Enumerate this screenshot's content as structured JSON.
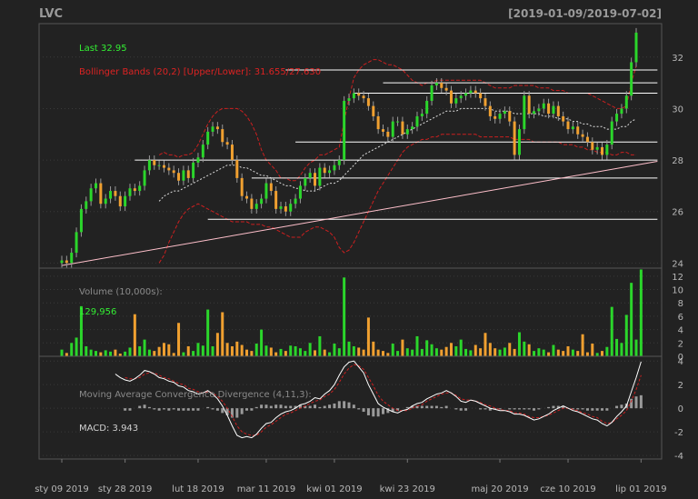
{
  "header": {
    "symbol": "LVC",
    "range": "[2019-01-09/2019-07-02]"
  },
  "annotations": {
    "last": "Last 32.95",
    "bbands": "Bollinger Bands (20,2) [Upper/Lower]: 31.655/27.630",
    "volume_title": "Volume (10,000s):",
    "volume_value": "129,956",
    "macd_title": "Moving Average Convergence Divergence (4,11,3):",
    "macd_value": "MACD: 3.943"
  },
  "colors": {
    "background": "#222222",
    "up": "#2bd62b",
    "down": "#f0a030",
    "bbands": "#cc1f1f",
    "last_text": "#33ee33",
    "bbands_text": "#dd2222",
    "macd_line": "#ffffff",
    "signal_line": "#cc2020",
    "hist": "#9a9a9a",
    "trendline": "#ffc0cb"
  },
  "chart_data": {
    "type": "candlestick",
    "x_ticks": [
      "sty 09 2019",
      "sty 28 2019",
      "lut 18 2019",
      "mar 11 2019",
      "kwi 01 2019",
      "kwi 23 2019",
      "maj 20 2019",
      "cze 10 2019",
      "lip 01 2019"
    ],
    "x_tick_index": [
      0,
      13,
      28,
      42,
      56,
      71,
      90,
      104,
      119
    ],
    "price": {
      "yticks": [
        "24",
        "26",
        "28",
        "30",
        "32"
      ],
      "ylim": [
        23.8,
        33.3
      ],
      "closes": [
        24.1,
        24.0,
        24.4,
        25.2,
        26.1,
        26.4,
        26.9,
        27.1,
        26.3,
        26.5,
        26.8,
        26.6,
        26.2,
        26.6,
        26.9,
        26.8,
        27.0,
        27.6,
        28.0,
        27.8,
        27.8,
        27.7,
        27.6,
        27.5,
        27.2,
        27.6,
        27.3,
        27.9,
        28.1,
        28.6,
        29.1,
        29.3,
        29.2,
        28.7,
        28.6,
        28.0,
        27.3,
        26.6,
        26.5,
        26.1,
        26.3,
        26.5,
        27.1,
        26.8,
        26.1,
        26.2,
        26.0,
        26.3,
        26.5,
        27.0,
        27.3,
        27.5,
        27.0,
        27.7,
        27.5,
        27.6,
        27.8,
        28.0,
        30.3,
        30.4,
        30.6,
        30.5,
        30.4,
        30.1,
        29.7,
        29.2,
        29.1,
        28.9,
        29.5,
        29.5,
        29.0,
        29.2,
        29.3,
        29.7,
        29.8,
        30.3,
        30.9,
        31.0,
        30.8,
        30.7,
        30.2,
        30.4,
        30.5,
        30.6,
        30.7,
        30.6,
        30.4,
        30.1,
        29.7,
        29.6,
        29.8,
        29.9,
        29.5,
        28.2,
        29.2,
        30.5,
        29.8,
        29.9,
        30.0,
        30.2,
        29.8,
        30.1,
        29.7,
        29.5,
        29.2,
        29.3,
        29.0,
        28.9,
        28.7,
        28.4,
        28.5,
        28.2,
        28.6,
        29.5,
        29.8,
        30.0,
        30.5,
        31.8,
        32.95
      ],
      "bb_upper": [
        null,
        null,
        null,
        null,
        null,
        null,
        null,
        null,
        null,
        null,
        null,
        null,
        null,
        null,
        null,
        null,
        null,
        null,
        null,
        null,
        28.2,
        28.3,
        28.2,
        28.2,
        28.1,
        28.2,
        28.2,
        28.3,
        28.6,
        29.0,
        29.4,
        29.7,
        29.9,
        30.0,
        30.0,
        30.0,
        30.0,
        29.9,
        29.7,
        29.4,
        29.0,
        28.4,
        28.0,
        27.8,
        27.6,
        27.3,
        27.3,
        27.2,
        27.2,
        27.4,
        27.7,
        27.9,
        28.0,
        28.2,
        28.2,
        28.3,
        28.4,
        28.5,
        29.5,
        30.4,
        31.2,
        31.5,
        31.7,
        31.8,
        31.9,
        31.9,
        31.8,
        31.7,
        31.7,
        31.6,
        31.5,
        31.3,
        31.1,
        31.0,
        30.9,
        31.0,
        31.0,
        31.1,
        31.1,
        31.1,
        31.1,
        31.1,
        31.1,
        31.1,
        31.1,
        31.1,
        31.1,
        31.0,
        30.9,
        30.8,
        30.8,
        30.8,
        30.8,
        30.9,
        30.9,
        30.9,
        30.9,
        30.9,
        30.8,
        30.8,
        30.8,
        30.7,
        30.7,
        30.7,
        30.6,
        30.6,
        30.6,
        30.6,
        30.6,
        30.5,
        30.4,
        30.3,
        30.2,
        30.1,
        30.0,
        30.0,
        30.1,
        31.0,
        31.65
      ],
      "bb_middle": [
        null,
        null,
        null,
        null,
        null,
        null,
        null,
        null,
        null,
        null,
        null,
        null,
        null,
        null,
        null,
        null,
        null,
        null,
        null,
        null,
        26.4,
        26.6,
        26.7,
        26.8,
        26.8,
        26.9,
        27.0,
        27.1,
        27.2,
        27.3,
        27.4,
        27.5,
        27.6,
        27.7,
        27.8,
        27.8,
        27.8,
        27.7,
        27.7,
        27.6,
        27.5,
        27.4,
        27.4,
        27.3,
        27.2,
        27.1,
        27.0,
        27.0,
        26.9,
        26.9,
        26.8,
        26.8,
        26.8,
        26.9,
        27.0,
        27.1,
        27.1,
        27.2,
        27.4,
        27.6,
        27.8,
        28.0,
        28.2,
        28.3,
        28.4,
        28.5,
        28.6,
        28.7,
        28.8,
        28.9,
        29.0,
        29.1,
        29.2,
        29.3,
        29.4,
        29.5,
        29.6,
        29.7,
        29.8,
        29.9,
        29.9,
        29.9,
        30.0,
        30.0,
        30.0,
        30.0,
        30.0,
        30.0,
        30.0,
        29.9,
        29.9,
        29.9,
        29.9,
        29.8,
        29.8,
        29.8,
        29.8,
        29.8,
        29.8,
        29.7,
        29.7,
        29.7,
        29.6,
        29.6,
        29.6,
        29.5,
        29.5,
        29.4,
        29.4,
        29.3,
        29.3,
        29.3,
        29.2,
        29.2,
        29.2,
        29.3,
        29.3,
        29.5,
        29.6
      ],
      "bb_lower": [
        null,
        null,
        null,
        null,
        null,
        null,
        null,
        null,
        null,
        null,
        null,
        null,
        null,
        null,
        null,
        null,
        null,
        null,
        null,
        null,
        24.0,
        24.3,
        24.8,
        25.2,
        25.6,
        25.9,
        26.1,
        26.2,
        26.3,
        26.2,
        26.1,
        26.0,
        25.9,
        25.8,
        25.7,
        25.6,
        25.6,
        25.6,
        25.6,
        25.5,
        25.5,
        25.5,
        25.4,
        25.4,
        25.3,
        25.2,
        25.1,
        25.0,
        25.0,
        25.0,
        25.2,
        25.3,
        25.4,
        25.4,
        25.3,
        25.2,
        25.0,
        24.6,
        24.4,
        24.5,
        24.8,
        25.2,
        25.6,
        26.0,
        26.4,
        26.8,
        27.1,
        27.4,
        27.7,
        28.0,
        28.3,
        28.5,
        28.6,
        28.7,
        28.8,
        28.8,
        28.9,
        28.9,
        29.0,
        29.0,
        29.0,
        29.0,
        29.0,
        29.0,
        29.0,
        29.0,
        28.9,
        28.9,
        28.9,
        28.9,
        28.9,
        28.9,
        28.9,
        28.8,
        28.8,
        28.8,
        28.8,
        28.7,
        28.7,
        28.7,
        28.7,
        28.7,
        28.7,
        28.6,
        28.6,
        28.6,
        28.5,
        28.5,
        28.4,
        28.4,
        28.3,
        28.3,
        28.3,
        28.2,
        28.2,
        28.3,
        28.3,
        28.2,
        28.2
      ],
      "hlines": [
        {
          "y": 31.5,
          "x0": 46,
          "x1": 119
        },
        {
          "y": 31.0,
          "x0": 66,
          "x1": 119
        },
        {
          "y": 30.6,
          "x0": 60,
          "x1": 119
        },
        {
          "y": 28.7,
          "x0": 48,
          "x1": 119
        },
        {
          "y": 28.0,
          "x0": 15,
          "x1": 119
        },
        {
          "y": 27.3,
          "x0": 39,
          "x1": 119
        },
        {
          "y": 25.7,
          "x0": 30,
          "x1": 119
        }
      ],
      "trendline": {
        "from": [
          0,
          23.9
        ],
        "to": [
          119,
          27.95
        ]
      }
    },
    "volume": {
      "yticks": [
        "0",
        "2",
        "4",
        "6",
        "8",
        "10",
        "12"
      ],
      "ylim": [
        0,
        13.2
      ],
      "values": [
        1.0,
        0.5,
        2.0,
        2.8,
        7.5,
        1.5,
        1.0,
        0.8,
        0.6,
        0.9,
        0.7,
        1.0,
        0.4,
        0.7,
        1.3,
        6.3,
        1.5,
        2.5,
        1.0,
        0.8,
        1.4,
        2.0,
        1.8,
        0.5,
        5.0,
        0.6,
        1.5,
        0.8,
        2.0,
        1.6,
        7.0,
        1.5,
        3.5,
        6.6,
        2.0,
        1.5,
        2.2,
        1.7,
        1.0,
        0.8,
        1.9,
        4.0,
        1.6,
        1.3,
        0.6,
        1.1,
        0.8,
        1.6,
        1.5,
        1.2,
        0.8,
        2.0,
        0.9,
        3.0,
        1.0,
        0.6,
        1.9,
        1.2,
        11.8,
        2.2,
        1.5,
        1.3,
        1.0,
        5.8,
        2.2,
        1.0,
        0.8,
        0.5,
        1.9,
        0.8,
        2.5,
        1.2,
        1.0,
        3.0,
        1.1,
        2.4,
        1.8,
        1.2,
        1.0,
        1.4,
        2.0,
        1.5,
        2.5,
        1.1,
        0.9,
        1.7,
        1.2,
        3.5,
        2.0,
        1.2,
        1.0,
        1.3,
        2.0,
        1.1,
        3.6,
        2.2,
        1.8,
        0.8,
        1.2,
        1.0,
        0.6,
        1.7,
        1.0,
        0.8,
        1.5,
        1.0,
        0.8,
        3.3,
        0.6,
        1.9,
        0.5,
        0.8,
        1.4,
        7.4,
        2.6,
        2.0,
        6.2,
        11.0,
        2.5,
        13.0
      ],
      "up": [
        1,
        0,
        1,
        1,
        1,
        1,
        1,
        1,
        0,
        1,
        1,
        0,
        0,
        1,
        1,
        0,
        1,
        1,
        1,
        0,
        0,
        0,
        0,
        0,
        0,
        1,
        0,
        1,
        1,
        1,
        1,
        1,
        0,
        0,
        0,
        0,
        0,
        0,
        0,
        0,
        1,
        1,
        1,
        0,
        0,
        1,
        0,
        1,
        1,
        1,
        1,
        1,
        0,
        1,
        0,
        1,
        1,
        1,
        1,
        1,
        1,
        0,
        0,
        0,
        0,
        0,
        0,
        0,
        1,
        1,
        0,
        1,
        1,
        1,
        1,
        1,
        1,
        1,
        0,
        0,
        0,
        1,
        1,
        1,
        1,
        0,
        0,
        0,
        0,
        0,
        1,
        1,
        0,
        0,
        1,
        1,
        0,
        1,
        1,
        1,
        0,
        1,
        0,
        0,
        0,
        1,
        0,
        0,
        0,
        0,
        1,
        0,
        1,
        1,
        1,
        1,
        1,
        1,
        1,
        1
      ]
    },
    "macd": {
      "yticks": [
        "-4",
        "-2",
        "0",
        "2",
        "4"
      ],
      "ylim": [
        -4.3,
        4.4
      ],
      "macd": [
        null,
        null,
        null,
        null,
        null,
        null,
        null,
        null,
        null,
        null,
        null,
        2.9,
        2.6,
        2.4,
        2.3,
        2.5,
        2.8,
        3.2,
        3.1,
        2.9,
        2.6,
        2.5,
        2.3,
        2.2,
        1.9,
        1.8,
        1.5,
        1.4,
        1.2,
        1.3,
        1.5,
        1.2,
        0.8,
        0.2,
        -0.6,
        -1.5,
        -2.3,
        -2.5,
        -2.4,
        -2.5,
        -2.2,
        -1.7,
        -1.3,
        -1.2,
        -0.8,
        -0.5,
        -0.3,
        -0.2,
        0.0,
        0.3,
        0.4,
        0.6,
        0.9,
        0.8,
        1.2,
        1.5,
        2.0,
        2.8,
        3.5,
        3.9,
        4.0,
        3.5,
        3.0,
        2.0,
        1.2,
        0.4,
        0.1,
        -0.1,
        -0.3,
        -0.4,
        -0.2,
        -0.1,
        0.2,
        0.4,
        0.5,
        0.8,
        1.0,
        1.2,
        1.3,
        1.5,
        1.3,
        1.0,
        0.6,
        0.5,
        0.7,
        0.6,
        0.4,
        0.2,
        0.0,
        -0.1,
        -0.2,
        -0.2,
        -0.3,
        -0.5,
        -0.5,
        -0.6,
        -0.8,
        -1.0,
        -0.9,
        -0.7,
        -0.5,
        -0.2,
        0.0,
        0.2,
        0.0,
        -0.2,
        -0.3,
        -0.5,
        -0.7,
        -0.9,
        -1.0,
        -1.3,
        -1.5,
        -1.2,
        -0.7,
        -0.3,
        0.2,
        1.4,
        2.6,
        3.943
      ],
      "signal": [
        null,
        null,
        null,
        null,
        null,
        null,
        null,
        null,
        null,
        null,
        null,
        null,
        null,
        2.6,
        2.5,
        2.5,
        2.6,
        2.9,
        3.0,
        3.0,
        2.8,
        2.6,
        2.5,
        2.3,
        2.1,
        2.0,
        1.7,
        1.6,
        1.4,
        1.3,
        1.4,
        1.3,
        1.0,
        0.6,
        0.0,
        -0.7,
        -1.5,
        -2.0,
        -2.2,
        -2.3,
        -2.3,
        -2.0,
        -1.6,
        -1.4,
        -1.1,
        -0.8,
        -0.5,
        -0.4,
        -0.2,
        0.0,
        0.2,
        0.4,
        0.6,
        0.7,
        1.0,
        1.2,
        1.6,
        2.2,
        2.9,
        3.4,
        3.7,
        3.6,
        3.3,
        2.6,
        1.9,
        1.1,
        0.6,
        0.3,
        0.0,
        -0.2,
        -0.2,
        -0.2,
        0.0,
        0.2,
        0.3,
        0.6,
        0.8,
        1.0,
        1.2,
        1.3,
        1.3,
        1.1,
        0.8,
        0.7,
        0.7,
        0.6,
        0.5,
        0.3,
        0.2,
        0.0,
        -0.1,
        -0.2,
        -0.2,
        -0.4,
        -0.4,
        -0.5,
        -0.7,
        -0.8,
        -0.8,
        -0.7,
        -0.6,
        -0.4,
        -0.2,
        0.0,
        0.0,
        -0.1,
        -0.2,
        -0.4,
        -0.5,
        -0.7,
        -0.8,
        -1.1,
        -1.3,
        -1.2,
        -0.9,
        -0.6,
        -0.2,
        0.6,
        1.6,
        2.8
      ],
      "hist": [
        0,
        0,
        0,
        0,
        0,
        0,
        0,
        0,
        0,
        0,
        0,
        0,
        0,
        -0.2,
        -0.2,
        0.0,
        0.2,
        0.3,
        0.1,
        -0.1,
        -0.2,
        -0.1,
        -0.2,
        -0.1,
        -0.2,
        -0.2,
        -0.2,
        -0.2,
        -0.2,
        0.0,
        0.1,
        -0.1,
        -0.2,
        -0.4,
        -0.6,
        -0.8,
        -0.8,
        -0.5,
        -0.2,
        -0.2,
        0.1,
        0.3,
        0.3,
        0.2,
        0.3,
        0.3,
        0.2,
        0.2,
        0.2,
        0.3,
        0.2,
        0.2,
        0.3,
        0.1,
        0.2,
        0.3,
        0.4,
        0.6,
        0.6,
        0.5,
        0.3,
        -0.1,
        -0.3,
        -0.6,
        -0.7,
        -0.7,
        -0.5,
        -0.4,
        -0.3,
        -0.2,
        0.0,
        0.1,
        0.2,
        0.2,
        0.2,
        0.2,
        0.2,
        0.2,
        0.1,
        0.2,
        0.0,
        -0.1,
        -0.2,
        -0.2,
        0.0,
        0.0,
        -0.1,
        -0.1,
        -0.2,
        -0.1,
        -0.1,
        0.0,
        -0.1,
        -0.1,
        -0.1,
        -0.1,
        -0.1,
        -0.2,
        -0.1,
        0.0,
        0.1,
        0.2,
        0.2,
        0.2,
        0.0,
        -0.1,
        -0.1,
        -0.1,
        -0.2,
        -0.2,
        -0.2,
        -0.2,
        -0.2,
        0.0,
        0.2,
        0.3,
        0.4,
        0.8,
        1.0,
        1.1
      ]
    }
  }
}
